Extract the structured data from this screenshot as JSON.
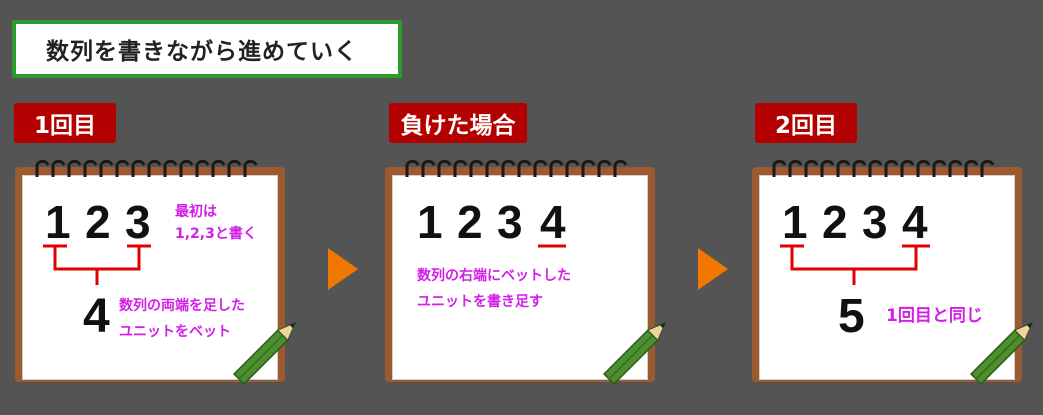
{
  "title": "数列を書きながら進めていく",
  "steps": [
    {
      "tag": "1回目",
      "digits": [
        "1",
        "2",
        "3"
      ],
      "result": "4",
      "note_top": [
        "最初は",
        "1,2,3と書く"
      ],
      "note_bottom": [
        "数列の両端を足した",
        "ユニットをベット"
      ]
    },
    {
      "tag": "負けた場合",
      "digits": [
        "1",
        "2",
        "3",
        "4"
      ],
      "note": [
        "数列の右端にベットした",
        "ユニットを書き足す"
      ]
    },
    {
      "tag": "2回目",
      "digits": [
        "1",
        "2",
        "3",
        "4"
      ],
      "result": "5",
      "note": "1回目と同じ"
    }
  ],
  "colors": {
    "background": "#545454",
    "title_border": "#2c9a2c",
    "tag": "#b30000",
    "underline": "#e00000",
    "note": "#d11fe6",
    "arrow": "#f07800"
  },
  "icons": [
    "spiral-notepad-icon",
    "pencil-icon",
    "arrow-right-icon"
  ]
}
